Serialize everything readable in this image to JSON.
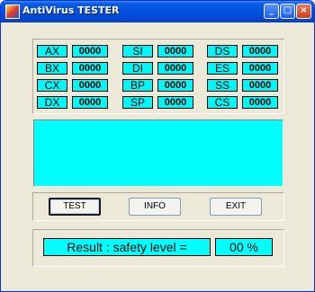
{
  "window": {
    "title": "AntiVirus TESTER"
  },
  "title_buttons": {
    "minimize": "_",
    "maximize": "□",
    "close": "×"
  },
  "registers": [
    {
      "name": "AX",
      "value": "0000"
    },
    {
      "name": "BX",
      "value": "0000"
    },
    {
      "name": "CX",
      "value": "0000"
    },
    {
      "name": "DX",
      "value": "0000"
    },
    {
      "name": "SI",
      "value": "0000"
    },
    {
      "name": "DI",
      "value": "0000"
    },
    {
      "name": "BP",
      "value": "0000"
    },
    {
      "name": "SP",
      "value": "0000"
    },
    {
      "name": "DS",
      "value": "0000"
    },
    {
      "name": "ES",
      "value": "0000"
    },
    {
      "name": "SS",
      "value": "0000"
    },
    {
      "name": "CS",
      "value": "0000"
    }
  ],
  "output": {
    "text": ""
  },
  "buttons": {
    "test": "TEST",
    "info": "INFO",
    "exit": "EXIT"
  },
  "result": {
    "label": "Result : safety level =",
    "value": "00 %"
  },
  "colors": {
    "field": "#00ffff",
    "window": "#ece9d8",
    "titlebar": "#0051dd"
  }
}
